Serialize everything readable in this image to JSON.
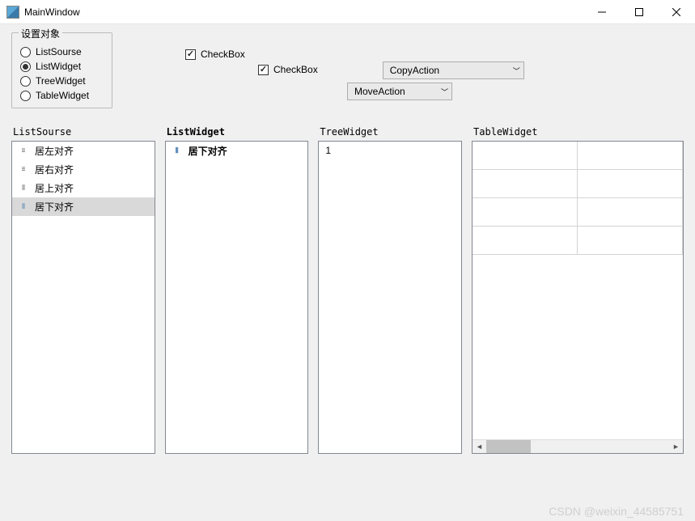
{
  "window": {
    "title": "MainWindow"
  },
  "groupbox": {
    "title": "设置对象",
    "radios": [
      {
        "label": "ListSourse",
        "checked": false
      },
      {
        "label": "ListWidget",
        "checked": true
      },
      {
        "label": "TreeWidget",
        "checked": false
      },
      {
        "label": "TableWidget",
        "checked": false
      }
    ]
  },
  "checkboxes": {
    "cb1": {
      "label": "CheckBox",
      "checked": true
    },
    "cb2": {
      "label": "CheckBox",
      "checked": true
    }
  },
  "combos": {
    "combo1": "CopyAction",
    "combo2": "MoveAction"
  },
  "panels": {
    "listsource": {
      "label": "ListSourse",
      "items": [
        {
          "text": "居左对齐",
          "icon": "align-left"
        },
        {
          "text": "居右对齐",
          "icon": "align-right"
        },
        {
          "text": "居上对齐",
          "icon": "align-top"
        },
        {
          "text": "居下对齐",
          "icon": "align-bottom",
          "selected": true
        }
      ]
    },
    "listwidget": {
      "label": "ListWidget",
      "items": [
        {
          "text": "居下对齐",
          "icon": "align-bottom",
          "bold": true
        }
      ]
    },
    "treewidget": {
      "label": "TreeWidget",
      "items": [
        {
          "text": "1"
        }
      ]
    },
    "tablewidget": {
      "label": "TableWidget"
    }
  },
  "watermark": "CSDN @weixin_44585751"
}
